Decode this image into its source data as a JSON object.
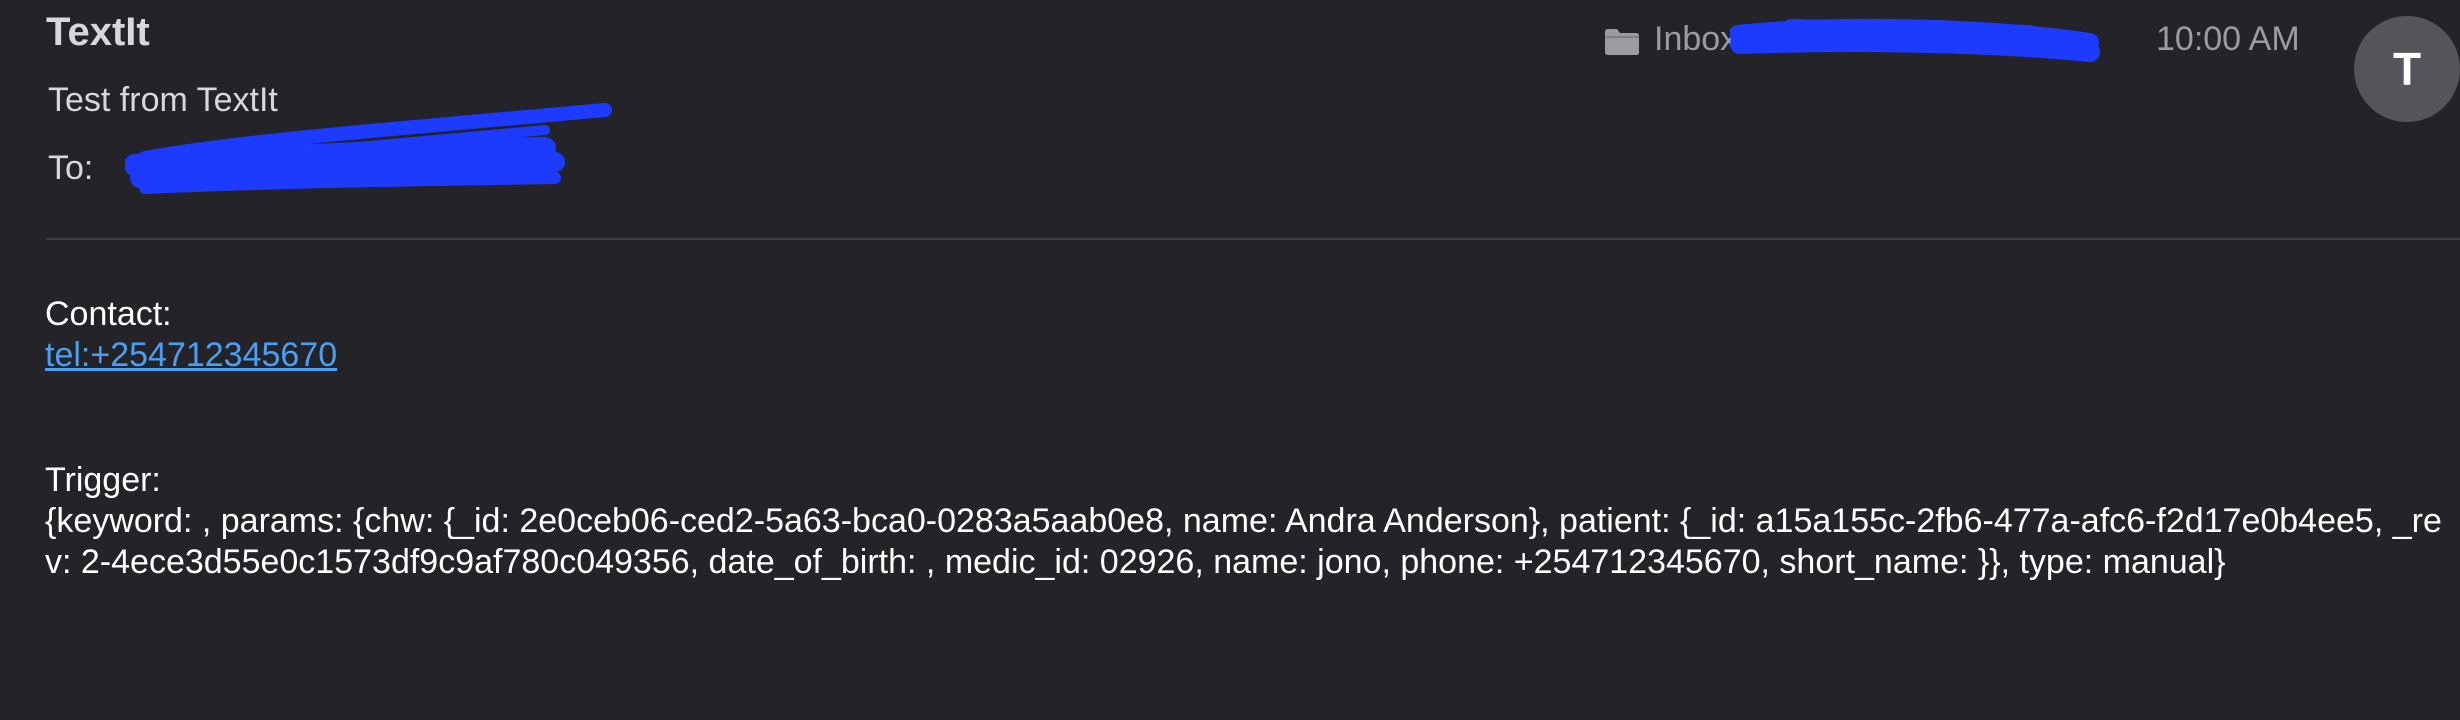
{
  "header": {
    "sender": "TextIt",
    "subject": "Test from TextIt",
    "to_label": "To:",
    "mailbox": "Inbox",
    "time": "10:00 AM",
    "avatar_initial": "T"
  },
  "body": {
    "contact_label": "Contact:",
    "contact_value": "tel:+254712345670",
    "trigger_label": "Trigger:",
    "trigger_value": "{keyword: , params: {chw: {_id: 2e0ceb06-ced2-5a63-bca0-0283a5aab0e8, name: Andra Anderson}, patient: {_id: a15a155c-2fb6-477a-afc6-f2d17e0b4ee5, _rev: 2-4ece3d55e0c1573df9c9af780c049356, date_of_birth: , medic_id: 02926, name: jono, phone: +254712345670, short_name: }}, type: manual}"
  },
  "icons": {
    "mailbox_icon": "folder-icon"
  },
  "colors": {
    "background": "#242428",
    "link": "#4a9ff5",
    "redaction": "#1c3bff",
    "avatar": "#545459"
  }
}
